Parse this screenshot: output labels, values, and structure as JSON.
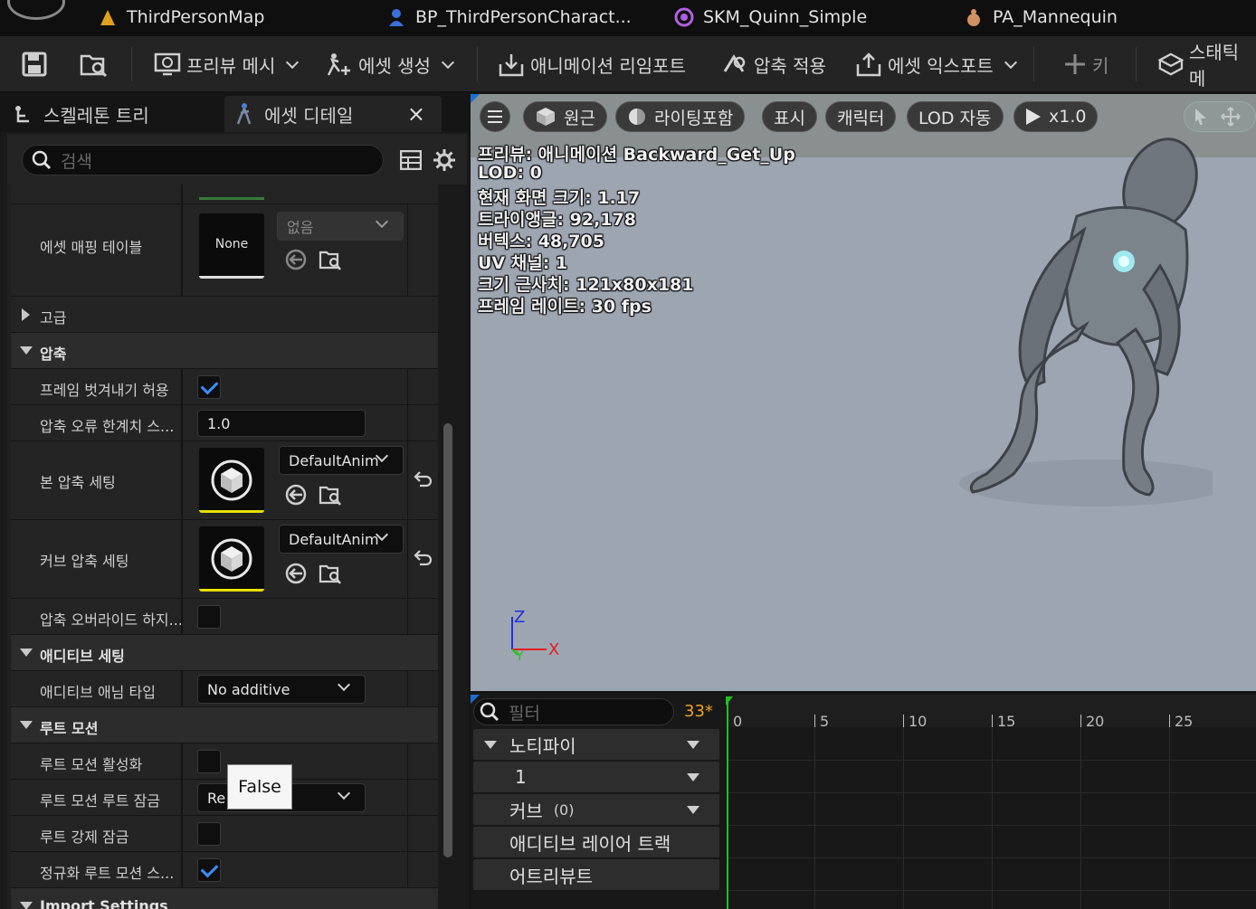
{
  "doc_tabs": [
    {
      "label": "ThirdPersonMap",
      "icon": "level-map-icon",
      "color": "#e0a020"
    },
    {
      "label": "BP_ThirdPersonCharact...",
      "icon": "blueprint-character-icon",
      "color": "#3a6fd8"
    },
    {
      "label": "SKM_Quinn_Simple",
      "icon": "skeletal-mesh-icon",
      "color": "#b060e0"
    },
    {
      "label": "PA_Mannequin",
      "icon": "physics-asset-icon",
      "color": "#d09060"
    }
  ],
  "toolbar": {
    "save_icon": "save-icon",
    "browse_icon": "browse-asset-icon",
    "preview_mesh": "프리뷰 메시",
    "create_asset": "에셋 생성",
    "reimport": "애니메이션 리임포트",
    "apply_compression": "압축 적용",
    "export_asset": "에셋 익스포트",
    "key": "키",
    "static_mesh": "스태틱 메"
  },
  "left_tabs": {
    "skeleton_tree": "스켈레톤 트리",
    "asset_details": "에셋 디테일",
    "close": "×"
  },
  "search": {
    "placeholder": "검색"
  },
  "details": {
    "asset_mapping_table": {
      "label": "에셋 매핑 테이블",
      "thumb_text": "None",
      "combo_value": "없음"
    },
    "advanced": "고급",
    "compression_category": "압축",
    "allow_frame_stripping": {
      "label": "프레임 벗겨내기 허용",
      "checked": true
    },
    "compression_error_threshold": {
      "label": "압축 오류 한계치 스...",
      "value": "1.0"
    },
    "bone_compression": {
      "label": "본 압축 세팅",
      "value": "DefaultAnim"
    },
    "curve_compression": {
      "label": "커브 압축 세팅",
      "value": "DefaultAnim"
    },
    "do_not_override_compression": {
      "label": "압축 오버라이드 하지...",
      "checked": false
    },
    "additive_category": "애디티브 세팅",
    "additive_anim_type": {
      "label": "애디티브 애님 타입",
      "value": "No additive"
    },
    "root_motion_category": "루트 모션",
    "enable_root_motion": {
      "label": "루트 모션 활성화",
      "checked": false
    },
    "root_motion_root_lock": {
      "label": "루트 모션 루트 잠금",
      "value": "Re"
    },
    "force_root_lock": {
      "label": "루트 강제 잠금",
      "checked": false
    },
    "normalize_root_motion": {
      "label": "정규화 루트 모션 스...",
      "checked": true
    },
    "import_settings_category": "Import Settings"
  },
  "tooltip": "False",
  "viewport": {
    "buttons": {
      "perspective": "원근",
      "lighting": "라이팅포함",
      "show": "표시",
      "character": "캐릭터",
      "lod": "LOD 자동",
      "speed": "x1.0"
    },
    "overlay_lines": [
      "프리뷰: 애니메이션 Backward_Get_Up",
      "LOD: 0",
      "현재 화면 크기: 1.17",
      "트라이앵글: 92,178",
      "버텍스: 48,705",
      "UV 채널: 1",
      "크기 근사치: 121x80x181",
      "프레임 레이트: 30 fps"
    ],
    "axis": {
      "z": "Z",
      "x": "X",
      "y": "Y"
    }
  },
  "timeline": {
    "filter_placeholder": "필터",
    "frame_count": "33*",
    "tracks": [
      {
        "label": "노티파이",
        "collapsible": true
      },
      {
        "label": "1"
      },
      {
        "label": "커브",
        "count": "(0)"
      },
      {
        "label": "애디티브 레이어 트랙"
      },
      {
        "label": "어트리뷰트"
      }
    ],
    "ruler_ticks": [
      "0",
      "5",
      "10",
      "15",
      "20",
      "25"
    ]
  }
}
